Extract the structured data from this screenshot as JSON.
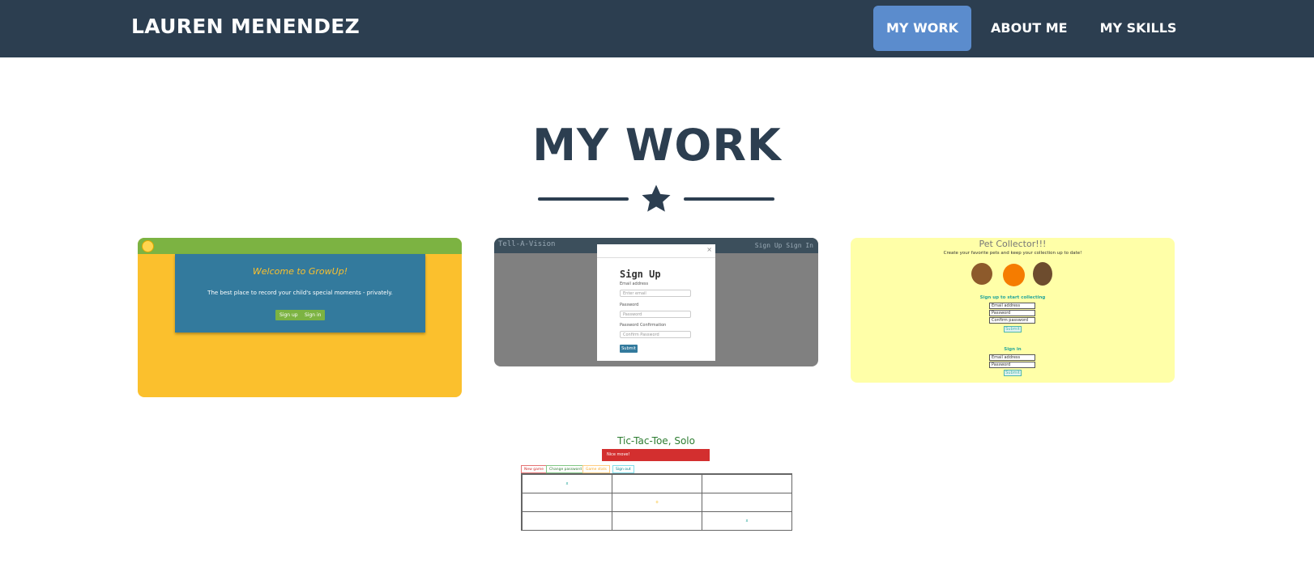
{
  "header": {
    "brand": "LAUREN MENENDEZ",
    "nav": [
      {
        "label": "MY WORK",
        "active": true
      },
      {
        "label": "ABOUT ME",
        "active": false
      },
      {
        "label": "MY SKILLS",
        "active": false
      }
    ]
  },
  "main": {
    "title": "MY WORK",
    "divider_icon": "star-icon",
    "projects": [
      {
        "name": "growup-screenshot",
        "heading": "Welcome to GrowUp!",
        "text": "The best place to record your child's special moments - privately.",
        "buttons": [
          "Sign up",
          "Sign in"
        ]
      },
      {
        "name": "tell-a-vision-screenshot",
        "brand": "Tell-A-Vision",
        "nav": "Sign Up  Sign In",
        "heading": "Sign Up",
        "fields": [
          {
            "label": "Email address",
            "placeholder": "Enter email"
          },
          {
            "label": "Password",
            "placeholder": "Password"
          },
          {
            "label": "Password Confirmation",
            "placeholder": "Confirm Password"
          }
        ],
        "submit": "Submit"
      },
      {
        "name": "pet-collector-screenshot",
        "heading": "Pet Collector!!!",
        "text": "Create your favorite pets and keep your collection up to date!",
        "signup_heading": "Sign up to start collecting",
        "signup_fields": [
          "Email address",
          "Password",
          "Confirm password"
        ],
        "submit": "Submit",
        "signin_heading": "Sign in",
        "signin_fields": [
          "Email address",
          "Password"
        ],
        "signin_submit": "Submit"
      },
      {
        "name": "tic-tac-toe-screenshot",
        "heading": "Tic-Tac-Toe, Solo",
        "alert": "Nice move!",
        "buttons": [
          "New game",
          "Change password",
          "Game stats",
          "Sign out"
        ],
        "cells": [
          "x",
          "",
          "",
          "",
          "o",
          "",
          "",
          "",
          "x"
        ]
      }
    ]
  },
  "colors": {
    "navbar": "#2c3e50",
    "active_nav": "#5b8ccd",
    "heading": "#2c3e50"
  }
}
